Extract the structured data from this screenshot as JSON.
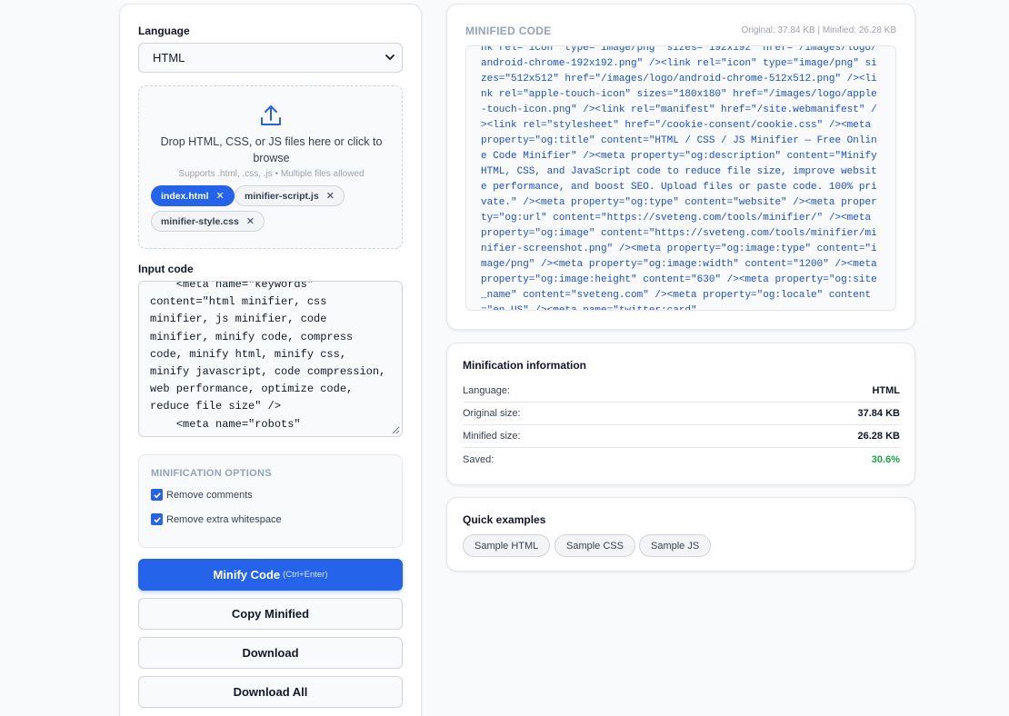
{
  "input_panel": {
    "language_label": "Language",
    "language_value": "HTML",
    "dropzone": {
      "message": "Drop HTML, CSS, or JS files here or click to browse",
      "hint": "Supports .html, .css, .js • Multiple files allowed"
    },
    "files": [
      {
        "name": "index.html",
        "active": true
      },
      {
        "name": "minifier-script.js",
        "active": false
      },
      {
        "name": "minifier-style.css",
        "active": false
      }
    ],
    "input_label": "Input code",
    "input_code": "    <meta name=\"keywords\"\ncontent=\"html minifier, css\nminifier, js minifier, code\nminifier, minify code, compress\ncode, minify html, minify css,\nminify javascript, code compression,\nweb performance, optimize code,\nreduce file size\" />\n    <meta name=\"robots\"\n    content=\"index, follow\" />",
    "options": {
      "title": "MINIFICATION OPTIONS",
      "remove_comments": "Remove comments",
      "remove_whitespace": "Remove extra whitespace"
    },
    "buttons": {
      "minify": "Minify Code",
      "minify_shortcut": "(Ctrl+Enter)",
      "copy": "Copy Minified",
      "download": "Download",
      "download_all": "Download All"
    }
  },
  "output_panel": {
    "title": "MINIFIED CODE",
    "sizes": "Original: 37.84 KB | Minified: 26.28 KB",
    "code": "nk rel=\"icon\" type=\"image/png\" sizes=\"192x192\" href=\"/images/logo/android-chrome-192x192.png\" /><link rel=\"icon\" type=\"image/png\" sizes=\"512x512\" href=\"/images/logo/android-chrome-512x512.png\" /><link rel=\"apple-touch-icon\" sizes=\"180x180\" href=\"/images/logo/apple-touch-icon.png\" /><link rel=\"manifest\" href=\"/site.webmanifest\" /><link rel=\"stylesheet\" href=\"/cookie-consent/cookie.css\" /><meta property=\"og:title\" content=\"HTML / CSS / JS Minifier — Free Online Code Minifier\" /><meta property=\"og:description\" content=\"Minify HTML, CSS, and JavaScript code to reduce file size, improve website performance, and boost SEO. Upload files or paste code. 100% private.\" /><meta property=\"og:type\" content=\"website\" /><meta property=\"og:url\" content=\"https://sveteng.com/tools/minifier/\" /><meta property=\"og:image\" content=\"https://sveteng.com/tools/minifier/minifier-screenshot.png\" /><meta property=\"og:image:type\" content=\"image/png\" /><meta property=\"og:image:width\" content=\"1200\" /><meta property=\"og:image:height\" content=\"630\" /><meta property=\"og:site_name\" content=\"sveteng.com\" /><meta property=\"og:locale\" content=\"en_US\" /><meta name=\"twitter:card\""
  },
  "info_panel": {
    "title": "Minification information",
    "rows": [
      {
        "label": "Language:",
        "value": "HTML"
      },
      {
        "label": "Original size:",
        "value": "37.84 KB"
      },
      {
        "label": "Minified size:",
        "value": "26.28 KB"
      },
      {
        "label": "Saved:",
        "value": "30.6%"
      }
    ]
  },
  "examples_panel": {
    "title": "Quick examples",
    "items": [
      "Sample HTML",
      "Sample CSS",
      "Sample JS"
    ]
  },
  "colors": {
    "accent": "#2563eb",
    "saved_green": "#16a34a",
    "code_blue": "#1d4ed8"
  }
}
